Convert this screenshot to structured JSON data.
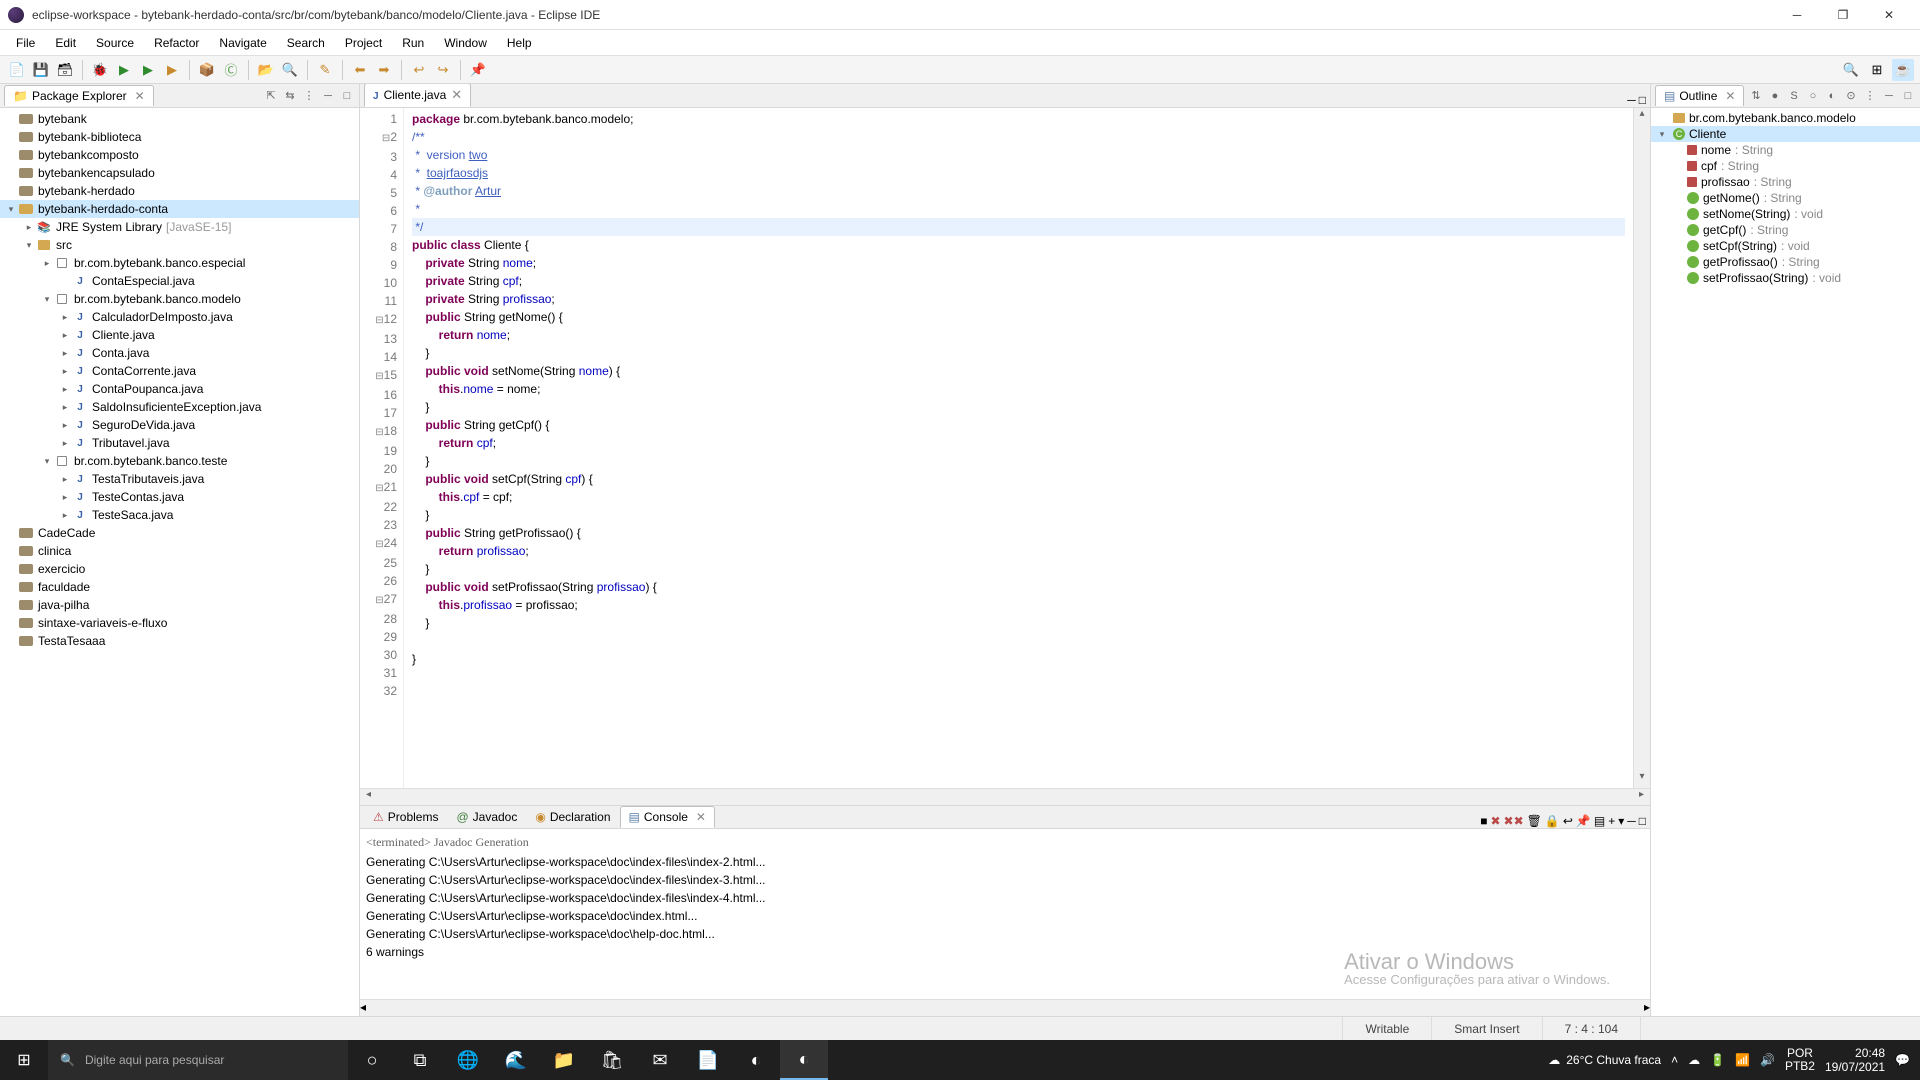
{
  "window": {
    "title": "eclipse-workspace - bytebank-herdado-conta/src/br/com/bytebank/banco/modelo/Cliente.java - Eclipse IDE"
  },
  "menu": [
    "File",
    "Edit",
    "Source",
    "Refactor",
    "Navigate",
    "Search",
    "Project",
    "Run",
    "Window",
    "Help"
  ],
  "packageExplorer": {
    "title": "Package Explorer",
    "items": [
      {
        "depth": 0,
        "arrow": "",
        "icon": "proj-closed",
        "label": "bytebank"
      },
      {
        "depth": 0,
        "arrow": "",
        "icon": "proj-closed",
        "label": "bytebank-biblioteca"
      },
      {
        "depth": 0,
        "arrow": "",
        "icon": "proj-closed",
        "label": "bytebankcomposto"
      },
      {
        "depth": 0,
        "arrow": "",
        "icon": "proj-closed",
        "label": "bytebankencapsulado"
      },
      {
        "depth": 0,
        "arrow": "",
        "icon": "proj-closed",
        "label": "bytebank-herdado"
      },
      {
        "depth": 0,
        "arrow": "▾",
        "icon": "proj",
        "label": "bytebank-herdado-conta",
        "selected": true
      },
      {
        "depth": 1,
        "arrow": "▸",
        "icon": "lib",
        "label": "JRE System Library",
        "suffix": "[JavaSE-15]"
      },
      {
        "depth": 1,
        "arrow": "▾",
        "icon": "src",
        "label": "src"
      },
      {
        "depth": 2,
        "arrow": "▸",
        "icon": "pkg",
        "label": "br.com.bytebank.banco.especial"
      },
      {
        "depth": 3,
        "arrow": "",
        "icon": "java",
        "label": "ContaEspecial.java"
      },
      {
        "depth": 2,
        "arrow": "▾",
        "icon": "pkg",
        "label": "br.com.bytebank.banco.modelo"
      },
      {
        "depth": 3,
        "arrow": "▸",
        "icon": "java",
        "label": "CalculadorDeImposto.java"
      },
      {
        "depth": 3,
        "arrow": "▸",
        "icon": "java",
        "label": "Cliente.java"
      },
      {
        "depth": 3,
        "arrow": "▸",
        "icon": "java",
        "label": "Conta.java"
      },
      {
        "depth": 3,
        "arrow": "▸",
        "icon": "java",
        "label": "ContaCorrente.java"
      },
      {
        "depth": 3,
        "arrow": "▸",
        "icon": "java",
        "label": "ContaPoupanca.java"
      },
      {
        "depth": 3,
        "arrow": "▸",
        "icon": "java",
        "label": "SaldoInsuficienteException.java"
      },
      {
        "depth": 3,
        "arrow": "▸",
        "icon": "java",
        "label": "SeguroDeVida.java"
      },
      {
        "depth": 3,
        "arrow": "▸",
        "icon": "java",
        "label": "Tributavel.java"
      },
      {
        "depth": 2,
        "arrow": "▾",
        "icon": "pkg",
        "label": "br.com.bytebank.banco.teste"
      },
      {
        "depth": 3,
        "arrow": "▸",
        "icon": "java",
        "label": "TestaTributaveis.java"
      },
      {
        "depth": 3,
        "arrow": "▸",
        "icon": "java",
        "label": "TesteContas.java"
      },
      {
        "depth": 3,
        "arrow": "▸",
        "icon": "java",
        "label": "TesteSaca.java"
      },
      {
        "depth": 0,
        "arrow": "",
        "icon": "proj-closed",
        "label": "CadeCade"
      },
      {
        "depth": 0,
        "arrow": "",
        "icon": "proj-closed",
        "label": "clinica"
      },
      {
        "depth": 0,
        "arrow": "",
        "icon": "proj-closed",
        "label": "exercicio"
      },
      {
        "depth": 0,
        "arrow": "",
        "icon": "proj-closed",
        "label": "faculdade"
      },
      {
        "depth": 0,
        "arrow": "",
        "icon": "proj-closed",
        "label": "java-pilha"
      },
      {
        "depth": 0,
        "arrow": "",
        "icon": "proj-closed",
        "label": "sintaxe-variaveis-e-fluxo"
      },
      {
        "depth": 0,
        "arrow": "",
        "icon": "proj-closed",
        "label": "TestaTesaaa"
      }
    ]
  },
  "editor": {
    "tab": "Cliente.java",
    "gutter": [
      {
        "n": "1",
        "m": ""
      },
      {
        "n": "2",
        "m": "⊟"
      },
      {
        "n": "3",
        "m": ""
      },
      {
        "n": "4",
        "m": ""
      },
      {
        "n": "5",
        "m": ""
      },
      {
        "n": "6",
        "m": ""
      },
      {
        "n": "7",
        "m": ""
      },
      {
        "n": "8",
        "m": ""
      },
      {
        "n": "9",
        "m": ""
      },
      {
        "n": "10",
        "m": ""
      },
      {
        "n": "11",
        "m": ""
      },
      {
        "n": "12",
        "m": "⊟"
      },
      {
        "n": "13",
        "m": ""
      },
      {
        "n": "14",
        "m": ""
      },
      {
        "n": "15",
        "m": "⊟"
      },
      {
        "n": "16",
        "m": ""
      },
      {
        "n": "17",
        "m": ""
      },
      {
        "n": "18",
        "m": "⊟"
      },
      {
        "n": "19",
        "m": ""
      },
      {
        "n": "20",
        "m": ""
      },
      {
        "n": "21",
        "m": "⊟"
      },
      {
        "n": "22",
        "m": ""
      },
      {
        "n": "23",
        "m": ""
      },
      {
        "n": "24",
        "m": "⊟"
      },
      {
        "n": "25",
        "m": ""
      },
      {
        "n": "26",
        "m": ""
      },
      {
        "n": "27",
        "m": "⊟"
      },
      {
        "n": "28",
        "m": ""
      },
      {
        "n": "29",
        "m": ""
      },
      {
        "n": "30",
        "m": ""
      },
      {
        "n": "31",
        "m": ""
      },
      {
        "n": "32",
        "m": ""
      }
    ],
    "code": {
      "l1_pkg": "package ",
      "l1_path": "br.com.bytebank.banco.modelo;",
      "l2": "/**",
      "l3a": " *  version ",
      "l3b": "two",
      "l4a": " *  ",
      "l4b": "toajrfaosdjs",
      "l5a": " * ",
      "l5b": "@author",
      "l5c": " ",
      "l5d": "Artur",
      "l6": " *",
      "l7": " */",
      "l8a": "public class ",
      "l8b": "Cliente",
      " l8c": " {",
      "l9a": "    private ",
      "l9b": "String ",
      "l9c": "nome",
      "l9d": ";",
      "l10a": "    private ",
      "l10b": "String ",
      "l10c": "cpf",
      "l10d": ";",
      "l11a": "    private ",
      "l11b": "String ",
      "l11c": "profissao",
      "l11d": ";",
      "l12a": "    public ",
      "l12b": "String getNome() {",
      "l13a": "        return ",
      "l13b": "nome",
      "l13c": ";",
      "l14": "    }",
      "l15a": "    public void ",
      "l15b": "setNome(String ",
      "l15c": "nome",
      "l15d": ") {",
      "l16a": "        this.",
      "l16b": "nome",
      "l16c": " = nome;",
      "l17": "    }",
      "l18a": "    public ",
      "l18b": "String getCpf() {",
      "l19a": "        return ",
      "l19b": "cpf",
      "l19c": ";",
      "l20": "    }",
      "l21a": "    public void ",
      "l21b": "setCpf(String ",
      "l21c": "cpf",
      "l21d": ") {",
      "l22a": "        this.",
      "l22b": "cpf",
      "l22c": " = cpf;",
      "l23": "    }",
      "l24a": "    public ",
      "l24b": "String getProfissao() {",
      "l25a": "        return ",
      "l25b": "profissao",
      "l25c": ";",
      "l26": "    }",
      "l27a": "    public void ",
      "l27b": "setProfissao(String ",
      "l27c": "profissao",
      "l27d": ") {",
      "l28a": "        this.",
      "l28b": "profissao",
      "l28c": " = profissao;",
      "l29": "    }",
      "l30": "",
      "l31": "}",
      "l32": ""
    }
  },
  "bottomTabs": {
    "problems": "Problems",
    "javadoc": "Javadoc",
    "declaration": "Declaration",
    "console": "Console"
  },
  "console": {
    "header": "<terminated> Javadoc Generation",
    "lines": [
      "Generating C:\\Users\\Artur\\eclipse-workspace\\doc\\index-files\\index-2.html...",
      "Generating C:\\Users\\Artur\\eclipse-workspace\\doc\\index-files\\index-3.html...",
      "Generating C:\\Users\\Artur\\eclipse-workspace\\doc\\index-files\\index-4.html...",
      "Generating C:\\Users\\Artur\\eclipse-workspace\\doc\\index.html...",
      "Generating C:\\Users\\Artur\\eclipse-workspace\\doc\\help-doc.html...",
      "6 warnings"
    ],
    "watermark_big": "Ativar o Windows",
    "watermark_small": "Acesse Configurações para ativar o Windows."
  },
  "outline": {
    "title": "Outline",
    "items": [
      {
        "depth": 0,
        "arrow": "",
        "icon": "pkg",
        "label": "br.com.bytebank.banco.modelo"
      },
      {
        "depth": 0,
        "arrow": "▾",
        "icon": "class",
        "label": "Cliente",
        "selected": true
      },
      {
        "depth": 1,
        "arrow": "",
        "icon": "field",
        "label": "nome",
        "type": ": String"
      },
      {
        "depth": 1,
        "arrow": "",
        "icon": "field",
        "label": "cpf",
        "type": ": String"
      },
      {
        "depth": 1,
        "arrow": "",
        "icon": "field",
        "label": "profissao",
        "type": ": String"
      },
      {
        "depth": 1,
        "arrow": "",
        "icon": "method",
        "label": "getNome()",
        "type": ": String"
      },
      {
        "depth": 1,
        "arrow": "",
        "icon": "method",
        "label": "setNome(String)",
        "type": ": void"
      },
      {
        "depth": 1,
        "arrow": "",
        "icon": "method",
        "label": "getCpf()",
        "type": ": String"
      },
      {
        "depth": 1,
        "arrow": "",
        "icon": "method",
        "label": "setCpf(String)",
        "type": ": void"
      },
      {
        "depth": 1,
        "arrow": "",
        "icon": "method",
        "label": "getProfissao()",
        "type": ": String"
      },
      {
        "depth": 1,
        "arrow": "",
        "icon": "method",
        "label": "setProfissao(String)",
        "type": ": void"
      }
    ]
  },
  "status": {
    "writable": "Writable",
    "insert": "Smart Insert",
    "pos": "7 : 4 : 104"
  },
  "taskbar": {
    "search_placeholder": "Digite aqui para pesquisar",
    "weather": "26°C  Chuva fraca",
    "lang1": "POR",
    "lang2": "PTB2",
    "time": "20:48",
    "date": "19/07/2021"
  }
}
